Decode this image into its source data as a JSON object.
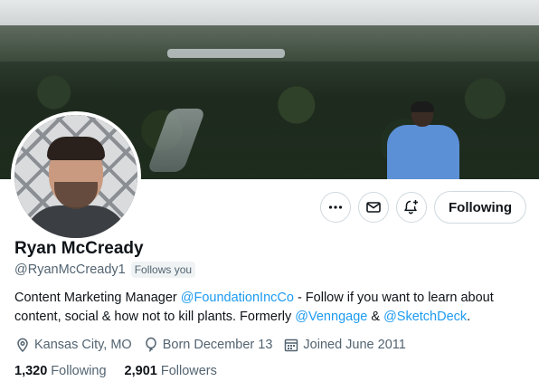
{
  "profile": {
    "name": "Ryan McCready",
    "handle": "@RyanMcCready1",
    "follows_you": "Follows you",
    "bio": {
      "part1": "Content Marketing Manager ",
      "mention1": "@FoundationIncCo",
      "part2": " - Follow if you want to learn about content, social & how not to kill plants. Formerly ",
      "mention2": "@Venngage",
      "part3": " & ",
      "mention3": "@SketchDeck",
      "part4": "."
    },
    "location": "Kansas City, MO",
    "birthday": "Born December 13",
    "joined": "Joined June 2011",
    "following_count": "1,320",
    "following_label": "Following",
    "followers_count": "2,901",
    "followers_label": "Followers"
  },
  "actions": {
    "more_icon": "more-icon",
    "message_icon": "envelope-icon",
    "notify_icon": "bell-plus-icon",
    "following_label": "Following"
  },
  "colors": {
    "accent": "#1d9bf0",
    "text": "#0f1419",
    "secondary": "#536471",
    "border": "#cfd9de"
  }
}
